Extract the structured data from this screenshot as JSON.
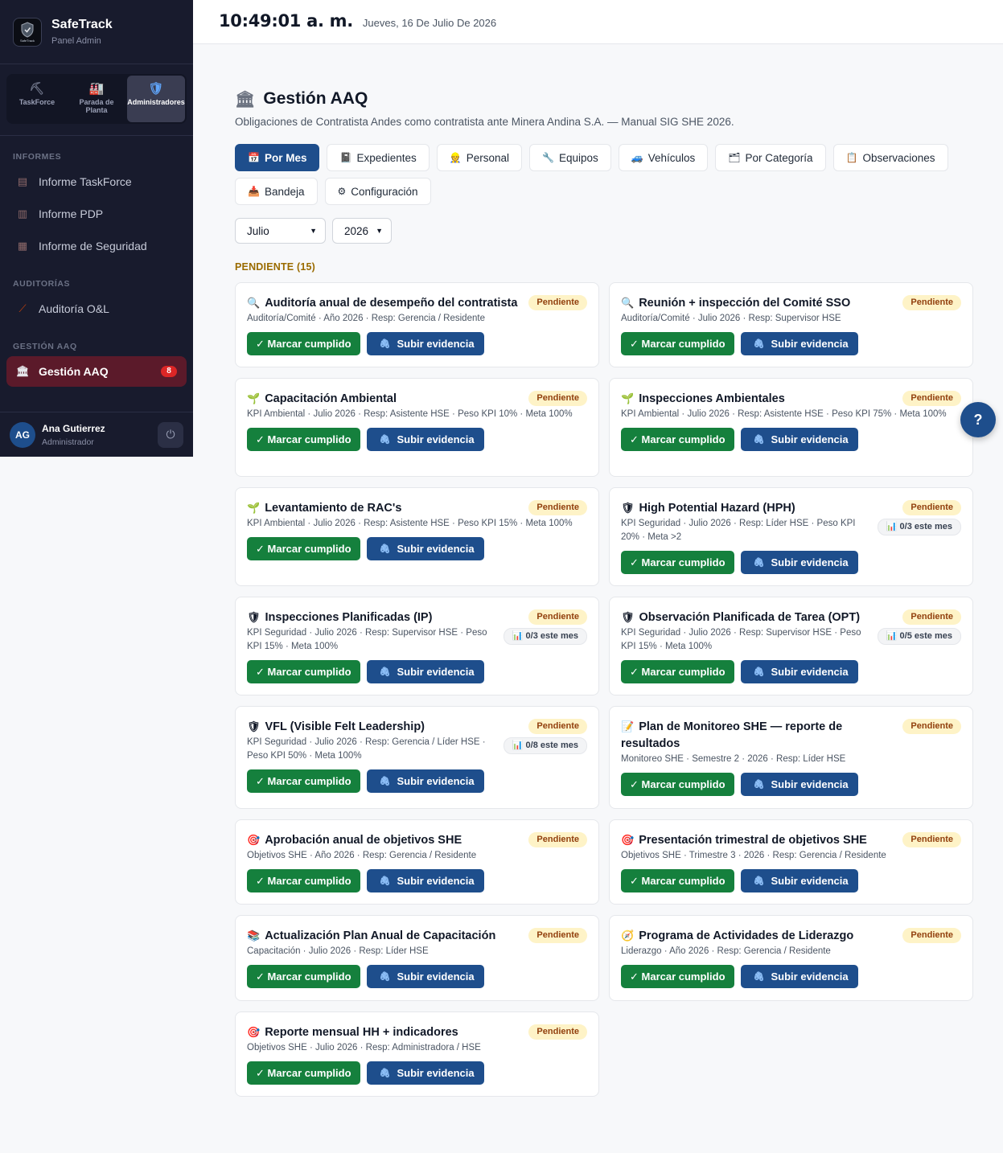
{
  "brand": {
    "name": "SafeTrack",
    "subtitle": "Panel Admin",
    "logo_text": "SafeTrack"
  },
  "switcher": [
    {
      "label": "TaskForce",
      "icon": "pickaxe-icon"
    },
    {
      "label": "Parada de Planta",
      "icon": "factory-icon"
    },
    {
      "label": "Administradores",
      "icon": "shield-icon",
      "active": true
    }
  ],
  "sidebar": {
    "sections": [
      {
        "title": "INFORMES",
        "items": [
          {
            "label": "Informe TaskForce",
            "icon": "document-icon"
          },
          {
            "label": "Informe PDP",
            "icon": "factory-icon"
          },
          {
            "label": "Informe de Seguridad",
            "icon": "safety-vest-icon"
          }
        ]
      },
      {
        "title": "AUDITORÍAS",
        "items": [
          {
            "label": "Auditoría O&L",
            "icon": "broom-icon"
          }
        ]
      },
      {
        "title": "GESTIÓN AAQ",
        "items": [
          {
            "label": "Gestión AAQ",
            "icon": "building-icon",
            "badge": "8",
            "active": true
          }
        ]
      }
    ]
  },
  "user": {
    "initials": "AG",
    "name": "Ana Gutierrez",
    "role": "Administrador"
  },
  "topbar": {
    "time": "10:49:01 a. m.",
    "date": "Jueves, 16 De Julio De 2026"
  },
  "page": {
    "title": "Gestión AAQ",
    "subtitle": "Obligaciones de Contratista Andes como contratista ante Minera Andina S.A. — Manual SIG SHE 2026."
  },
  "tabs": [
    {
      "label": "Por Mes",
      "icon": "📅",
      "active": true
    },
    {
      "label": "Expedientes",
      "icon": "📓"
    },
    {
      "label": "Personal",
      "icon": "👷"
    },
    {
      "label": "Equipos",
      "icon": "🔧"
    },
    {
      "label": "Vehículos",
      "icon": "🚙"
    },
    {
      "label": "Por Categoría",
      "icon": "🗂"
    },
    {
      "label": "Observaciones",
      "icon": "📋"
    },
    {
      "label": "Bandeja",
      "icon": "📥"
    },
    {
      "label": "Configuración",
      "icon": "⚙"
    }
  ],
  "filters": {
    "month": "Julio",
    "year": "2026"
  },
  "section": {
    "title": "PENDIENTE (15)"
  },
  "buttons": {
    "complete": "✓ Marcar cumplido",
    "evidence": "Subir evidencia"
  },
  "cards": [
    {
      "icon": "🔍",
      "title": "Auditoría anual de desempeño del contratista",
      "meta": "Auditoría/Comité · Año 2026 · Resp: Gerencia / Residente",
      "status": "Pendiente",
      "progress": ""
    },
    {
      "icon": "🔍",
      "title": "Reunión + inspección del Comité SSO",
      "meta": "Auditoría/Comité · Julio 2026 · Resp: Supervisor HSE",
      "status": "Pendiente",
      "progress": ""
    },
    {
      "icon": "🌱",
      "title": "Capacitación Ambiental",
      "meta": "KPI Ambiental · Julio 2026 · Resp: Asistente HSE · Peso KPI 10% · Meta 100%",
      "status": "Pendiente",
      "progress": ""
    },
    {
      "icon": "🌱",
      "title": "Inspecciones Ambientales",
      "meta": "KPI Ambiental · Julio 2026 · Resp: Asistente HSE · Peso KPI 75% · Meta 100%",
      "status": "Pendiente",
      "progress": ""
    },
    {
      "icon": "🌱",
      "title": "Levantamiento de RAC's",
      "meta": "KPI Ambiental · Julio 2026 · Resp: Asistente HSE · Peso KPI 15% · Meta 100%",
      "status": "Pendiente",
      "progress": ""
    },
    {
      "icon": "🛡",
      "title": "High Potential Hazard (HPH)",
      "meta": "KPI Seguridad · Julio 2026 · Resp: Líder HSE · Peso KPI 20% · Meta >2",
      "status": "Pendiente",
      "progress": "📊 0/3 este mes"
    },
    {
      "icon": "🛡",
      "title": "Inspecciones Planificadas (IP)",
      "meta": "KPI Seguridad · Julio 2026 · Resp: Supervisor HSE · Peso KPI 15% · Meta 100%",
      "status": "Pendiente",
      "progress": "📊 0/3 este mes"
    },
    {
      "icon": "🛡",
      "title": "Observación Planificada de Tarea (OPT)",
      "meta": "KPI Seguridad · Julio 2026 · Resp: Supervisor HSE · Peso KPI 15% · Meta 100%",
      "status": "Pendiente",
      "progress": "📊 0/5 este mes"
    },
    {
      "icon": "🛡",
      "title": "VFL (Visible Felt Leadership)",
      "meta": "KPI Seguridad · Julio 2026 · Resp: Gerencia / Líder HSE · Peso KPI 50% · Meta 100%",
      "status": "Pendiente",
      "progress": "📊 0/8 este mes"
    },
    {
      "icon": "📝",
      "title": "Plan de Monitoreo SHE — reporte de resultados",
      "meta": "Monitoreo SHE · Semestre 2 · 2026 · Resp: Líder HSE",
      "status": "Pendiente",
      "progress": ""
    },
    {
      "icon": "🎯",
      "title": "Aprobación anual de objetivos SHE",
      "meta": "Objetivos SHE · Año 2026 · Resp: Gerencia / Residente",
      "status": "Pendiente",
      "progress": ""
    },
    {
      "icon": "🎯",
      "title": "Presentación trimestral de objetivos SHE",
      "meta": "Objetivos SHE · Trimestre 3 · 2026 · Resp: Gerencia / Residente",
      "status": "Pendiente",
      "progress": ""
    },
    {
      "icon": "📚",
      "title": "Actualización Plan Anual de Capacitación",
      "meta": "Capacitación · Julio 2026 · Resp: Líder HSE",
      "status": "Pendiente",
      "progress": ""
    },
    {
      "icon": "🧭",
      "title": "Programa de Actividades de Liderazgo",
      "meta": "Liderazgo · Año 2026 · Resp: Gerencia / Residente",
      "status": "Pendiente",
      "progress": ""
    },
    {
      "icon": "🎯",
      "title": "Reporte mensual HH + indicadores",
      "meta": "Objetivos SHE · Julio 2026 · Resp: Administradora / HSE",
      "status": "Pendiente",
      "progress": ""
    }
  ],
  "help": {
    "label": "?"
  }
}
